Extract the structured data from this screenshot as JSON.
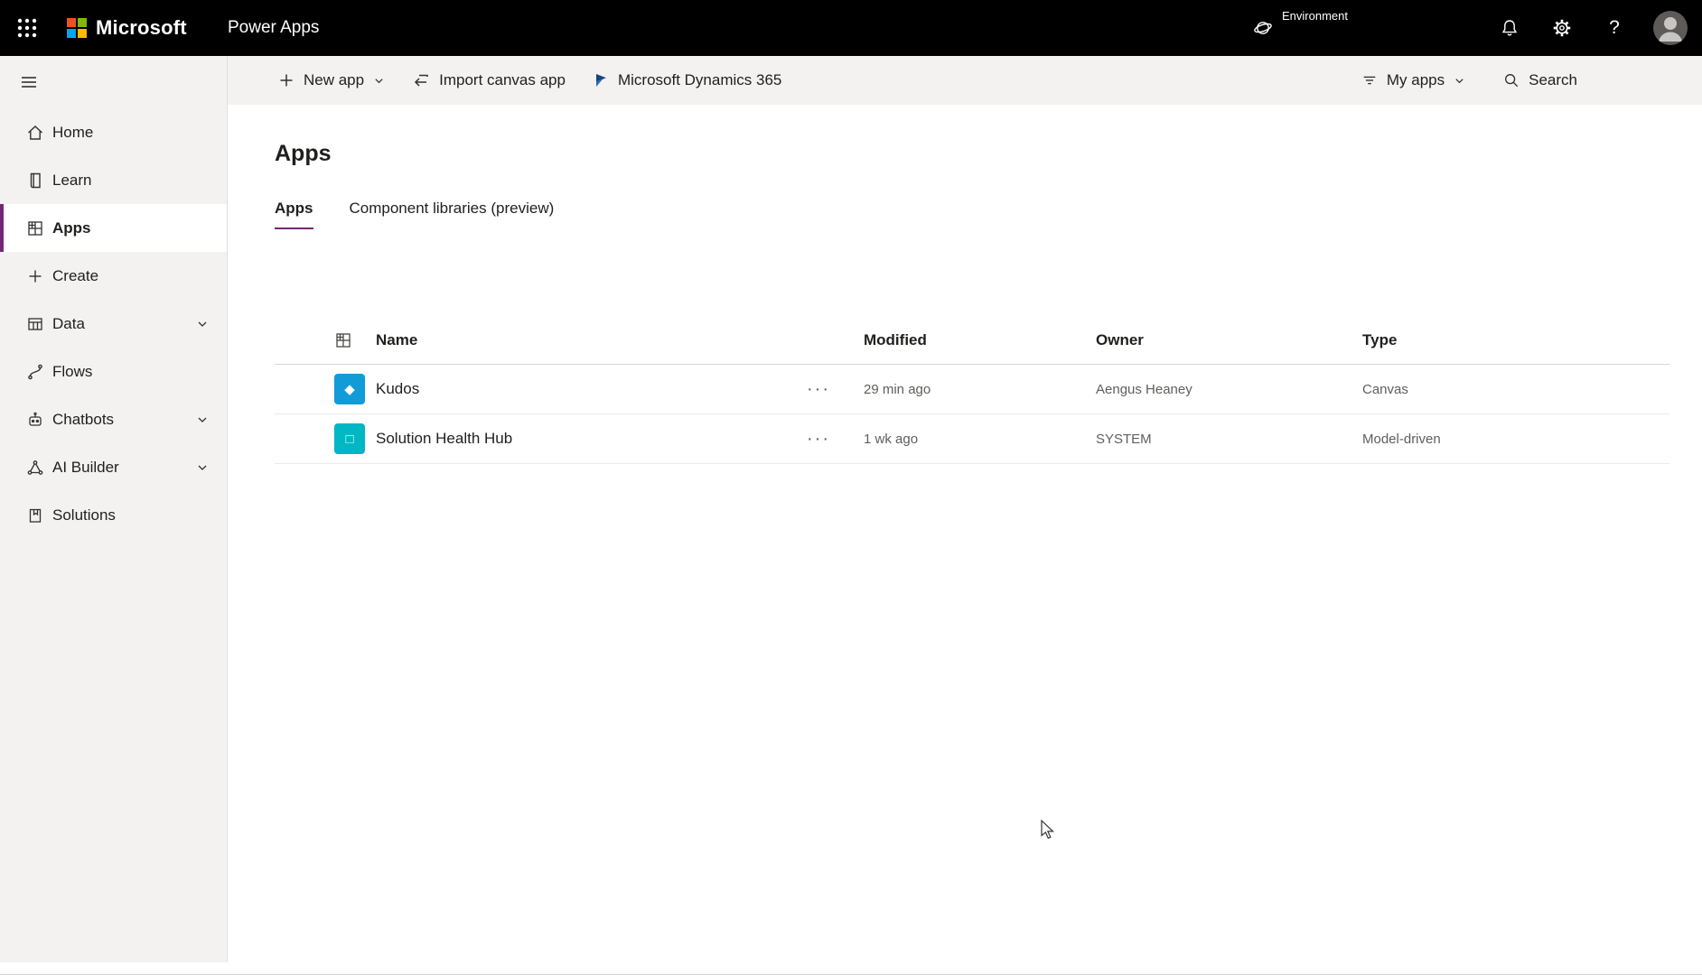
{
  "topbar": {
    "brand": "Microsoft",
    "product": "Power Apps",
    "environment_label": "Environment"
  },
  "sidebar": {
    "items": [
      {
        "label": "Home",
        "icon": "home-icon"
      },
      {
        "label": "Learn",
        "icon": "book-icon"
      },
      {
        "label": "Apps",
        "icon": "apps-grid-icon",
        "active": true
      },
      {
        "label": "Create",
        "icon": "plus-icon"
      },
      {
        "label": "Data",
        "icon": "table-icon",
        "expandable": true
      },
      {
        "label": "Flows",
        "icon": "flow-icon"
      },
      {
        "label": "Chatbots",
        "icon": "bot-icon",
        "expandable": true
      },
      {
        "label": "AI Builder",
        "icon": "network-icon",
        "expandable": true
      },
      {
        "label": "Solutions",
        "icon": "solutions-icon"
      }
    ]
  },
  "command_bar": {
    "new_app": "New app",
    "import_canvas_app": "Import canvas app",
    "dynamics": "Microsoft Dynamics 365",
    "my_apps": "My apps",
    "search": "Search"
  },
  "page": {
    "title": "Apps",
    "tabs": [
      {
        "label": "Apps",
        "active": true
      },
      {
        "label": "Component libraries (preview)",
        "active": false
      }
    ]
  },
  "table": {
    "columns": {
      "name": "Name",
      "modified": "Modified",
      "owner": "Owner",
      "type": "Type"
    },
    "rows": [
      {
        "name": "Kudos",
        "modified": "29 min ago",
        "owner": "Aengus Heaney",
        "type": "Canvas",
        "icon_color": "#119bd7",
        "icon_glyph": "◆",
        "menu": "···"
      },
      {
        "name": "Solution Health Hub",
        "modified": "1 wk ago",
        "owner": "SYSTEM",
        "type": "Model-driven",
        "icon_color": "#00b7c3",
        "icon_glyph": "□",
        "menu": "···"
      }
    ]
  },
  "colors": {
    "accent": "#742774",
    "topbar_bg": "#000000",
    "microsoft_logo": [
      "#f25022",
      "#7fba00",
      "#00a4ef",
      "#ffb900"
    ],
    "kudos_icon": "#119bd7",
    "solution_health_hub_icon": "#00b7c3"
  }
}
